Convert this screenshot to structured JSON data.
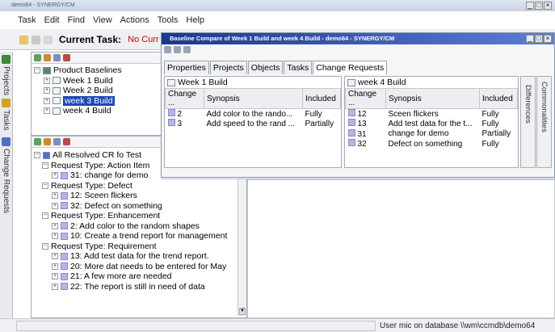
{
  "window": {
    "title": "demo64 - SYNERGY/CM"
  },
  "menu": [
    {
      "label": "Task"
    },
    {
      "label": "Edit"
    },
    {
      "label": "Find"
    },
    {
      "label": "View"
    },
    {
      "label": "Actions"
    },
    {
      "label": "Tools"
    },
    {
      "label": "Help"
    }
  ],
  "current_task": {
    "label": "Current Task:",
    "value": "No Curr"
  },
  "side_tabs": {
    "projects": "Projects",
    "tasks": "Tasks",
    "change_requests": "Change Requests"
  },
  "baselines": {
    "root": "Product Baselines",
    "items": [
      "Week 1 Build",
      "Week 2 Build",
      "week 3 Build",
      "week 4 Build"
    ],
    "selected": "week 3 Build"
  },
  "cr_tree": {
    "root": "All Resolved CR fo Test",
    "groups": [
      {
        "label": "Request Type: Action Item",
        "items": [
          "31: change for demo"
        ]
      },
      {
        "label": "Request Type: Defect",
        "items": [
          "12: Sceen flickers",
          "32: Defect on something"
        ]
      },
      {
        "label": "Request Type: Enhancement",
        "items": [
          "2: Add color to the random shapes",
          "10: Create a trend report for management"
        ]
      },
      {
        "label": "Request Type: Requirement",
        "items": [
          "13: Add test data for the trend report.",
          "20: More dat needs to be entered for May",
          "21: A few more are needed",
          "22: The report is still in need of data"
        ]
      }
    ]
  },
  "dialog": {
    "title": "Baseline Compare of Week 1 Build and week 4 Build - demo64 - SYNERGY/CM",
    "tabs": [
      "Properties",
      "Projects",
      "Objects",
      "Tasks",
      "Change Requests"
    ],
    "active_tab": "Change Requests",
    "side_tabs": {
      "commonalities": "Commonalities",
      "differences": "Differences"
    },
    "left": {
      "header": "Week 1 Build",
      "columns": [
        "Change ...",
        "Synopsis",
        "Included"
      ],
      "rows": [
        {
          "id": "2",
          "synopsis": "Add color to the rando...",
          "included": "Fully"
        },
        {
          "id": "3",
          "synopsis": "Add speed to the rand ...",
          "included": "Partially"
        }
      ]
    },
    "right": {
      "header": "week 4 Build",
      "columns": [
        "Change ...",
        "Synopsis",
        "Included"
      ],
      "rows": [
        {
          "id": "12",
          "synopsis": "Sceen flickers",
          "included": "Fully"
        },
        {
          "id": "13",
          "synopsis": "Add test data for the t...",
          "included": "Fully"
        },
        {
          "id": "31",
          "synopsis": "change for demo",
          "included": "Partially"
        },
        {
          "id": "32",
          "synopsis": "Defect on something",
          "included": "Fully"
        }
      ]
    }
  },
  "status": {
    "text": "User mic on database \\\\wm\\ccmdb\\demo64"
  }
}
